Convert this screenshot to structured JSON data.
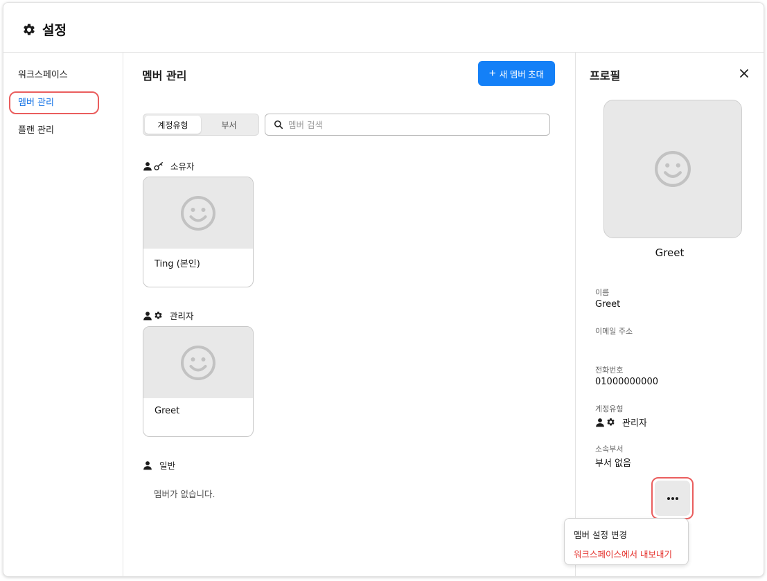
{
  "header": {
    "title": "설정",
    "icon": "gear-icon"
  },
  "sidebar": {
    "items": [
      {
        "label": "워크스페이스",
        "active": false
      },
      {
        "label": "멤버 관리",
        "active": true
      },
      {
        "label": "플랜 관리",
        "active": false
      }
    ]
  },
  "main": {
    "title": "멤버 관리",
    "invite_button": {
      "icon": "plus-icon",
      "label": "새 멤버 초대"
    },
    "segments": [
      {
        "label": "계정유형",
        "selected": true
      },
      {
        "label": "부서",
        "selected": false
      }
    ],
    "search": {
      "placeholder": "멤버 검색",
      "value": ""
    },
    "groups": [
      {
        "label": "소유자",
        "icons": [
          "person-icon",
          "key-icon"
        ],
        "members": [
          "Ting (본인)"
        ]
      },
      {
        "label": "관리자",
        "icons": [
          "person-icon",
          "gear-icon"
        ],
        "members": [
          "Greet"
        ]
      },
      {
        "label": "일반",
        "icons": [
          "person-icon"
        ],
        "members": [],
        "empty_text": "멤버가 없습니다."
      }
    ]
  },
  "profile": {
    "title": "프로필",
    "name": "Greet",
    "fields": [
      {
        "label": "이름",
        "value": "Greet"
      },
      {
        "label": "이메일 주소",
        "value": ""
      },
      {
        "label": "전화번호",
        "value": "01000000000"
      },
      {
        "label": "계정유형",
        "value": "관리자",
        "icons": [
          "person-icon",
          "gear-icon"
        ]
      },
      {
        "label": "소속부서",
        "value": "부서 없음"
      }
    ],
    "more_button": "more-options-icon"
  },
  "dropdown_menu": {
    "items": [
      {
        "label": "멤버 설정 변경",
        "danger": false
      },
      {
        "label": "워크스페이스에서 내보내기",
        "danger": true
      }
    ]
  },
  "colors": {
    "accent": "#1480f7",
    "active_nav_text": "#1473e6",
    "highlight_outline": "#ea5d5d",
    "danger": "#e5322d"
  }
}
